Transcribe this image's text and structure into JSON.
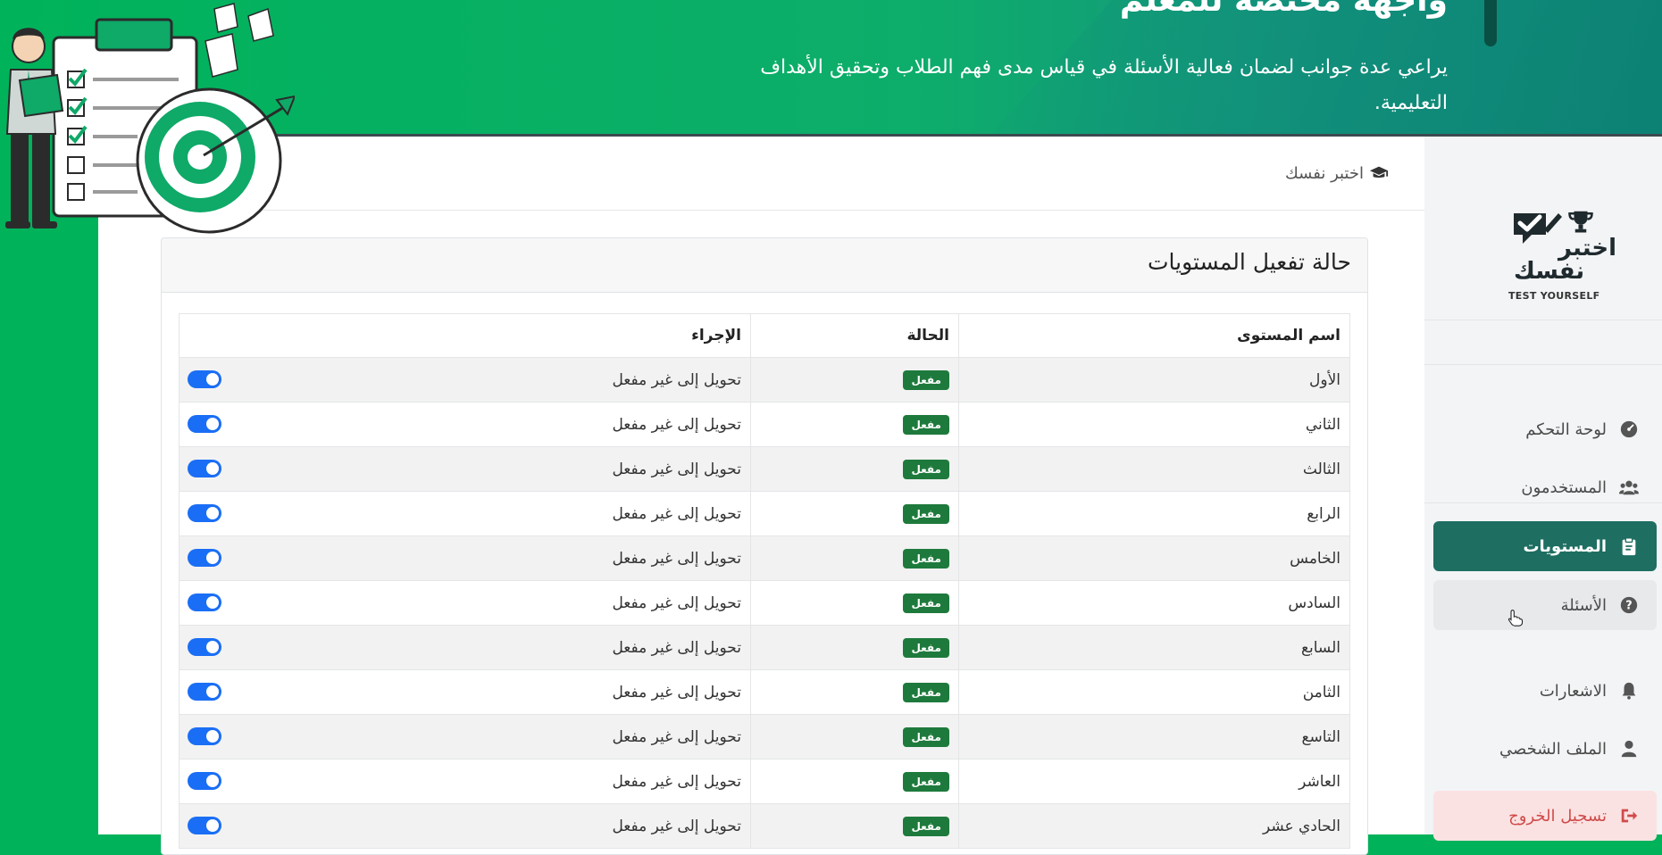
{
  "hero": {
    "title": "واجهة مختصة للمعلم",
    "description": "يراعي عدة جوانب لضمان فعالية الأسئلة في قياس مدى فهم الطلاب وتحقيق الأهداف التعليمية."
  },
  "topbar": {
    "brand_label": "اختبر نفسك",
    "brand_icon": "graduation-cap-icon"
  },
  "card": {
    "title": "حالة تفعيل المستويات"
  },
  "table": {
    "headers": {
      "name": "اسم المستوى",
      "status": "الحالة",
      "action": "الإجراء"
    },
    "rows": [
      {
        "name": "الأول",
        "status": "مفعل",
        "action": "تحويل إلى غير مفعل",
        "toggle_on": true
      },
      {
        "name": "الثاني",
        "status": "مفعل",
        "action": "تحويل إلى غير مفعل",
        "toggle_on": true
      },
      {
        "name": "الثالث",
        "status": "مفعل",
        "action": "تحويل إلى غير مفعل",
        "toggle_on": true
      },
      {
        "name": "الرابع",
        "status": "مفعل",
        "action": "تحويل إلى غير مفعل",
        "toggle_on": true
      },
      {
        "name": "الخامس",
        "status": "مفعل",
        "action": "تحويل إلى غير مفعل",
        "toggle_on": true
      },
      {
        "name": "السادس",
        "status": "مفعل",
        "action": "تحويل إلى غير مفعل",
        "toggle_on": true
      },
      {
        "name": "السابع",
        "status": "مفعل",
        "action": "تحويل إلى غير مفعل",
        "toggle_on": true
      },
      {
        "name": "الثامن",
        "status": "مفعل",
        "action": "تحويل إلى غير مفعل",
        "toggle_on": true
      },
      {
        "name": "التاسع",
        "status": "مفعل",
        "action": "تحويل إلى غير مفعل",
        "toggle_on": true
      },
      {
        "name": "العاشر",
        "status": "مفعل",
        "action": "تحويل إلى غير مفعل",
        "toggle_on": true
      },
      {
        "name": "الحادي عشر",
        "status": "مفعل",
        "action": "تحويل إلى غير مفعل",
        "toggle_on": true
      }
    ]
  },
  "sidebar": {
    "logo": {
      "title_line1": "اختبر",
      "title_line2": "نفسك",
      "tagline": "TEST YOURSELF"
    },
    "items": [
      {
        "label": "لوحة التحكم",
        "icon": "dashboard-icon"
      },
      {
        "label": "المستخدمون",
        "icon": "users-icon"
      },
      {
        "label": "المستويات",
        "icon": "clipboard-icon"
      },
      {
        "label": "الأسئلة",
        "icon": "question-circle-icon"
      },
      {
        "label": "الاشعارات",
        "icon": "bell-icon"
      },
      {
        "label": "الملف الشخصي",
        "icon": "user-icon"
      },
      {
        "label": "تسجيل الخروج",
        "icon": "logout-icon"
      }
    ]
  },
  "colors": {
    "brand_green": "#00b25a",
    "active_nav": "#1e6e62",
    "status_badge": "#1e7a3c",
    "toggle_on": "#1a6ef5",
    "logout": "#d04b4b"
  }
}
